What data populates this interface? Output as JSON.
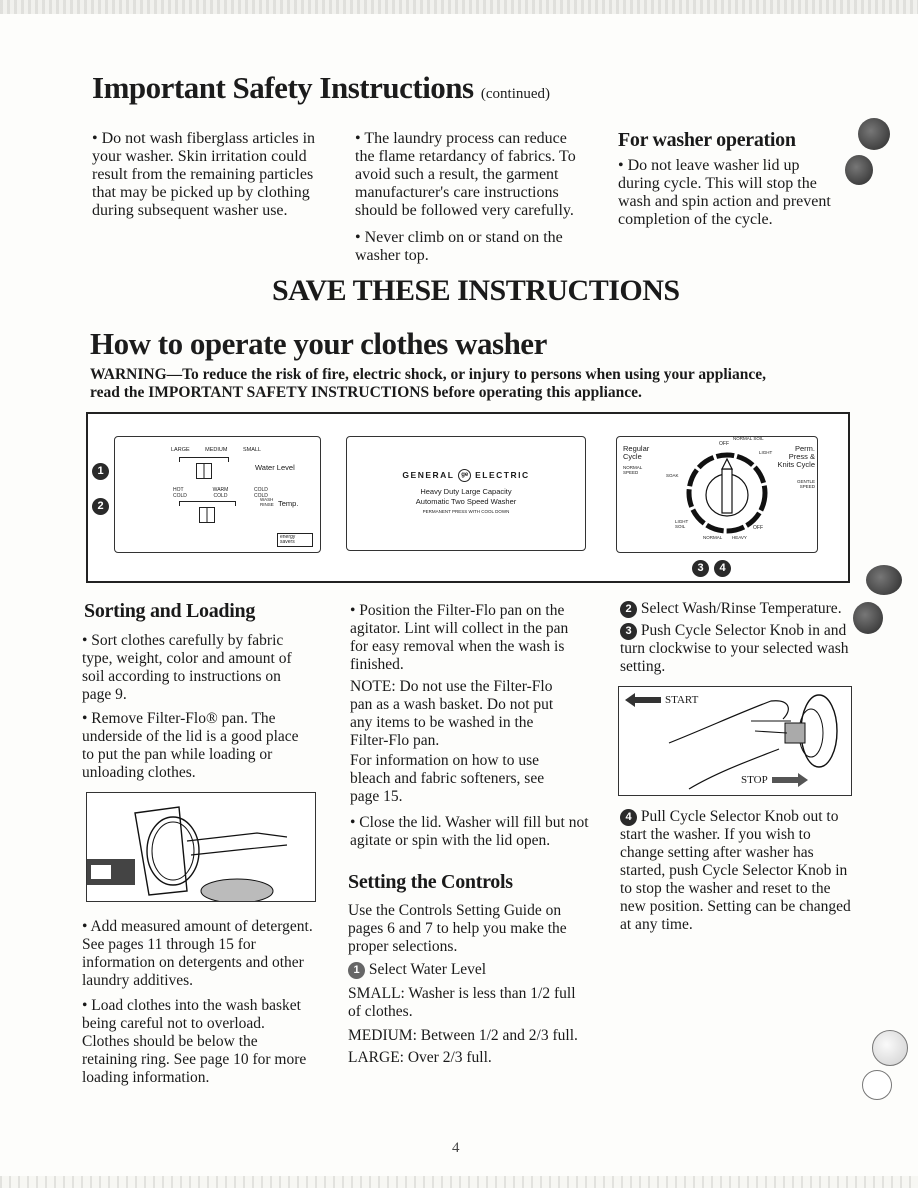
{
  "page": {
    "number": "4"
  },
  "safety": {
    "title": "Important Safety Instructions",
    "title_suffix": "(continued)",
    "col1": "• Do not wash fiberglass articles in your washer. Skin irritation could result from the remaining particles that may be picked up by clothing during subsequent washer use.",
    "col2a": "• The laundry process can reduce the flame retardancy of fabrics. To avoid such a result, the garment manufacturer's care instructions should be followed very carefully.",
    "col2b": "• Never climb on or stand on the washer top.",
    "washer_op_heading": "For washer operation",
    "washer_op_text": "• Do not leave washer lid up during cycle. This will stop the wash and spin action and prevent completion of the cycle.",
    "save_banner": "SAVE THESE INSTRUCTIONS"
  },
  "operate": {
    "title": "How to operate your clothes washer",
    "warning": "WARNING—To reduce the risk of fire, electric shock, or injury to persons when using your appliance, read the IMPORTANT SAFETY INSTRUCTIONS before operating this appliance."
  },
  "control_panel": {
    "callouts": [
      "1",
      "2",
      "3",
      "4"
    ],
    "water_level": {
      "label": "Water Level",
      "options": [
        "LARGE",
        "MEDIUM",
        "SMALL"
      ]
    },
    "temp": {
      "label": "Temp.",
      "sublabel_top": "WASH",
      "sublabel_bottom": "RINSE",
      "options": [
        "HOT COLD",
        "WARM COLD",
        "COLD COLD"
      ]
    },
    "energy_badge": "energy savers",
    "brand": {
      "left": "GENERAL",
      "right": "ELECTRIC",
      "logo": "ge-logo",
      "line1": "Heavy Duty Large Capacity",
      "line2": "Automatic Two Speed Washer",
      "line3": "PERMANENT PRESS WITH COOL DOWN"
    },
    "dial": {
      "regular_cycle": "Regular Cycle",
      "regular_speed": "NORMAL SPEED",
      "perm_press": "Perm. Press & Knits Cycle",
      "perm_speed": "GENTLE SPEED",
      "off_top": "OFF",
      "normal_soil": "NORMAL SOIL",
      "light": "LIGHT",
      "soak": "SOAK",
      "light_soil": "LIGHT SOIL",
      "normal": "NORMAL",
      "heavy": "HEAVY",
      "off_bottom": "OFF"
    }
  },
  "sorting": {
    "heading": "Sorting and Loading",
    "p1": "• Sort clothes carefully by fabric type, weight, color and amount of soil according to instructions on page 9.",
    "p2": "• Remove Filter-Flo® pan. The underside of the lid is a good place to put the pan while loading or unloading clothes.",
    "p3": "• Add measured amount of detergent. See pages 11 through 15 for information on detergents and other laundry additives.",
    "p4": "• Load clothes into the wash basket being careful not to overload. Clothes should be below the retaining ring. See page 10 for more loading information."
  },
  "middle": {
    "p1": "• Position the Filter-Flo pan on the agitator. Lint will collect in the pan for easy removal when the wash is finished.",
    "note": "NOTE: Do not use the Filter-Flo pan as a wash basket. Do not put any items to be washed in the Filter-Flo pan.",
    "bleach": "For information on how to use bleach and fabric softeners, see page 15.",
    "close": "• Close the lid. Washer will fill but not agitate or spin with the lid open.",
    "controls_heading": "Setting the Controls",
    "controls_intro": "Use the Controls Setting Guide on pages 6 and 7 to help you make the proper selections.",
    "step1": "Select Water Level",
    "small": "SMALL: Washer is less than 1/2 full of clothes.",
    "medium": "MEDIUM: Between 1/2 and 2/3 full.",
    "large": "LARGE: Over 2/3 full."
  },
  "right": {
    "step2": "Select Wash/Rinse Temperature.",
    "step3": "Push Cycle Selector Knob in and turn clockwise to your selected wash setting.",
    "start_label": "START",
    "stop_label": "STOP",
    "step4": "Pull Cycle Selector Knob out to start the washer. If you wish to change setting after washer has started, push Cycle Selector Knob in to stop the washer and reset to the new position. Setting can be changed at any time."
  }
}
